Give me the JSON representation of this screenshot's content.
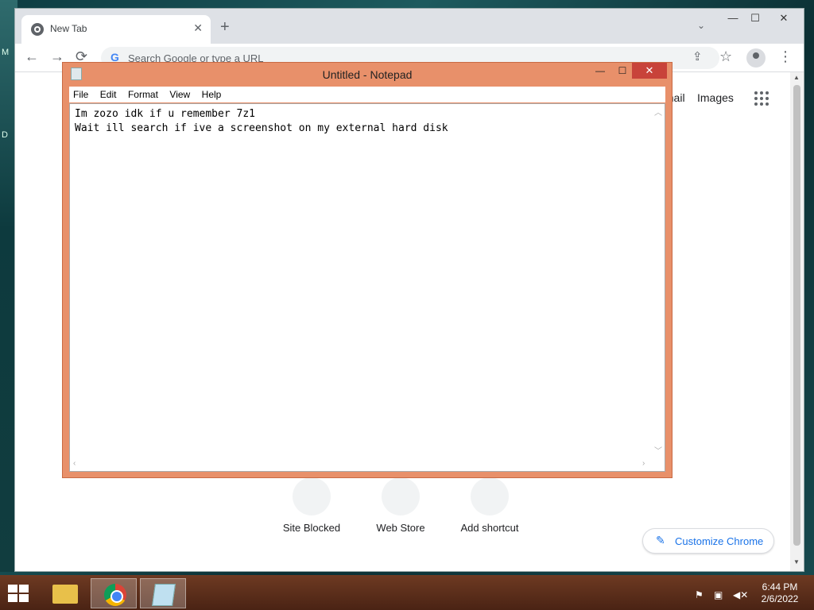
{
  "desktop": {
    "labels": [
      "M",
      "D"
    ]
  },
  "chrome": {
    "tab_title": "New Tab",
    "tab_close": "✕",
    "new_tab": "+",
    "tab_search": "⌄",
    "window_controls": {
      "minimize": "—",
      "maximize": "☐",
      "close": "✕"
    },
    "nav": {
      "back": "←",
      "forward": "→",
      "reload": "⟳"
    },
    "omnibox_placeholder": "Search Google or type a URL",
    "omnibox_g": "G",
    "toolbar_icons": {
      "share": "⇪",
      "bookmark": "☆",
      "menu": "⋮"
    },
    "header_links": {
      "gmail": "Gmail",
      "images": "Images"
    },
    "shortcuts": [
      {
        "label": "Site Blocked"
      },
      {
        "label": "Web Store"
      },
      {
        "label": "Add shortcut"
      }
    ],
    "customize_label": "Customize Chrome",
    "customize_icon": "✎"
  },
  "notepad": {
    "title": "Untitled - Notepad",
    "controls": {
      "minimize": "—",
      "maximize": "☐",
      "close": "✕"
    },
    "menu": [
      "File",
      "Edit",
      "Format",
      "View",
      "Help"
    ],
    "content": "Im zozo idk if u remember 7z1\nWait ill search if ive a screenshot on my external hard disk"
  },
  "taskbar": {
    "time": "6:44 PM",
    "date": "2/6/2022",
    "tray_icons": [
      "flag-icon",
      "network-icon",
      "volume-muted-icon"
    ]
  }
}
